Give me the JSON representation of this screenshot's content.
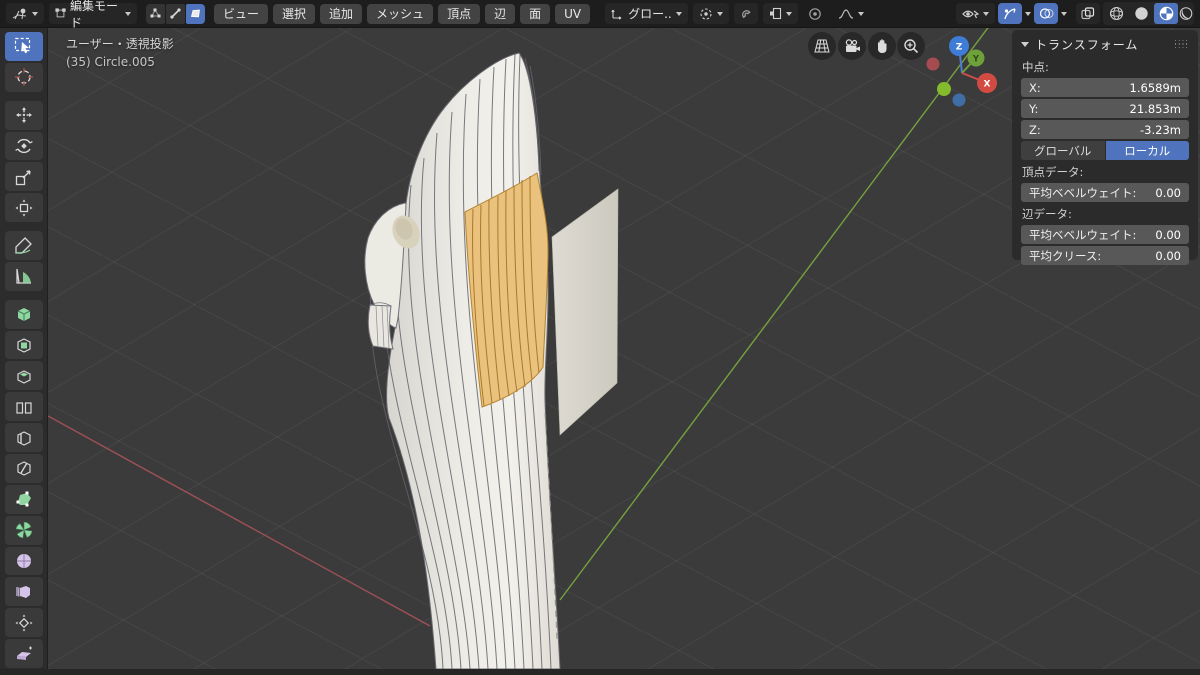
{
  "topbar": {
    "editor_icon": "viewport-3d-icon",
    "mode_selector": {
      "label": "編集モード",
      "icon": "edit-mode-icon"
    },
    "select_modes": {
      "vertex": "vertex-select",
      "edge": "edge-select",
      "face": "face-select",
      "active": "face"
    },
    "menus": [
      "ビュー",
      "選択",
      "追加",
      "メッシュ",
      "頂点",
      "辺",
      "面",
      "UV"
    ],
    "orientation": {
      "label": "グロー.."
    },
    "active_shading": "material-preview"
  },
  "toolbar": {
    "tools": [
      "select-box",
      "cursor",
      "move",
      "rotate",
      "scale",
      "transform",
      "annotate",
      "measure",
      "add-cube",
      "extrude-region",
      "inset-faces",
      "bevel",
      "loop-cut",
      "knife",
      "poly-build",
      "spin",
      "smooth",
      "edge-slide",
      "shrink-fatten",
      "shear"
    ],
    "active": "select-box"
  },
  "viewport": {
    "view_label": "ユーザー・透視投影",
    "object_label": "(35) Circle.005",
    "nav_buttons": [
      "perspective-grid",
      "camera-view",
      "pan-hand",
      "zoom-plus"
    ],
    "axis_gizmo": {
      "x": "X",
      "y": "Y",
      "z": "Z"
    }
  },
  "transform_panel": {
    "title": "トランスフォーム",
    "median_label": "中点:",
    "median": [
      {
        "label": "X:",
        "value": "1.6589m"
      },
      {
        "label": "Y:",
        "value": "21.853m"
      },
      {
        "label": "Z:",
        "value": "-3.23m"
      }
    ],
    "space": {
      "global": "グローバル",
      "local": "ローカル",
      "active": "ローカル"
    },
    "vertex_data_label": "頂点データ:",
    "vertex_rows": [
      {
        "label": "平均ベベルウェイト:",
        "value": "0.00"
      }
    ],
    "edge_data_label": "辺データ:",
    "edge_rows": [
      {
        "label": "平均ベベルウェイト:",
        "value": "0.00"
      },
      {
        "label": "平均クリース:",
        "value": "0.00"
      }
    ]
  },
  "colors": {
    "accent_blue": "#4f74bd",
    "selection_orange": "#eac27d",
    "axis_red": "#a05058",
    "axis_green": "#77a13d",
    "gizmo_x": "#d24b43",
    "gizmo_y": "#6fa13a",
    "gizmo_z": "#3e7cd6"
  }
}
